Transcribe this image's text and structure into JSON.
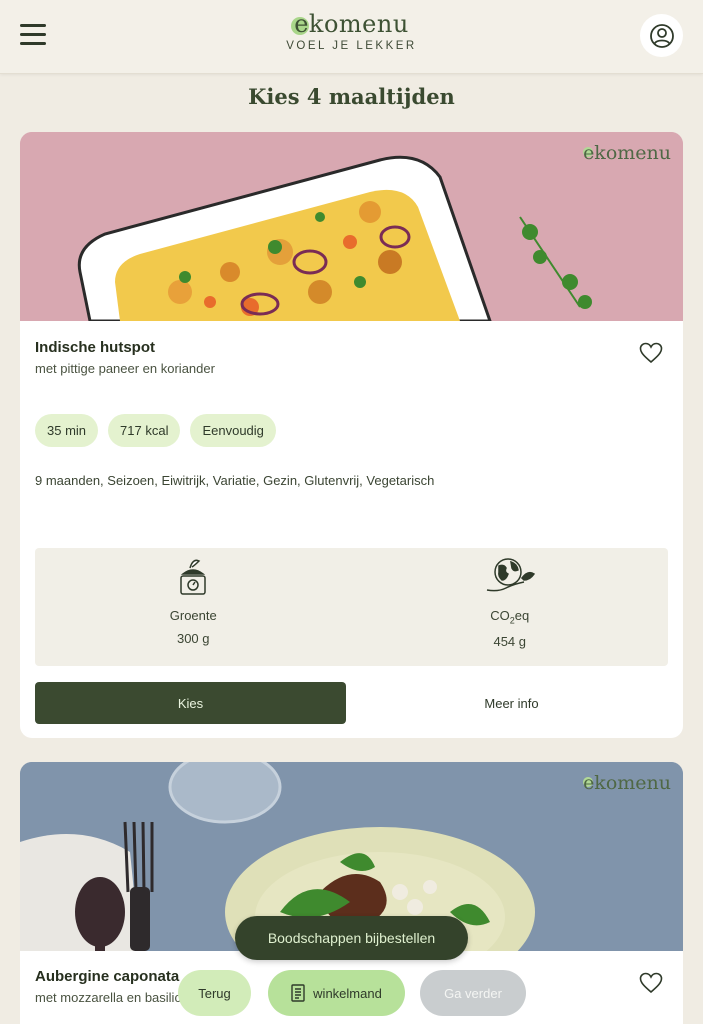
{
  "header": {
    "logo_text": "ekomenu",
    "tagline": "VOEL JE LEKKER",
    "menu_icon": "hamburger-icon",
    "account_icon": "user-circle-icon"
  },
  "page": {
    "title": "Kies 4 maaltijden"
  },
  "colors": {
    "background": "#f0ece3",
    "primary_dark_green": "#3b4a30",
    "chip_green": "#e4f2cf",
    "accent_green": "#b7e19a",
    "disabled_grey": "#c9cdcf"
  },
  "recipes": [
    {
      "watermark": "ekomenu",
      "name": "Indische hutspot",
      "subtitle": "met pittige paneer en koriander",
      "chips": [
        "35 min",
        "717 kcal",
        "Eenvoudig"
      ],
      "tags": "9 maanden,  Seizoen,  Eiwitrijk,  Variatie,  Gezin,  Glutenvrij,  Vegetarisch",
      "stats": [
        {
          "icon": "scale-icon",
          "label": "Groente",
          "value": "300 g"
        },
        {
          "icon": "earth-hand-icon",
          "label_main": "CO",
          "label_sub": "2",
          "label_tail": "eq",
          "value": "454 g"
        }
      ],
      "choose_label": "Kies",
      "more_label": "Meer info"
    },
    {
      "watermark": "ekomenu",
      "name": "Aubergine caponata",
      "subtitle": "met mozzarella en basilicum"
    }
  ],
  "footer": {
    "extra_groceries_label": "Boodschappen bijbestellen",
    "back_label": "Terug",
    "cart_label": "winkelmand",
    "next_label": "Ga verder"
  }
}
